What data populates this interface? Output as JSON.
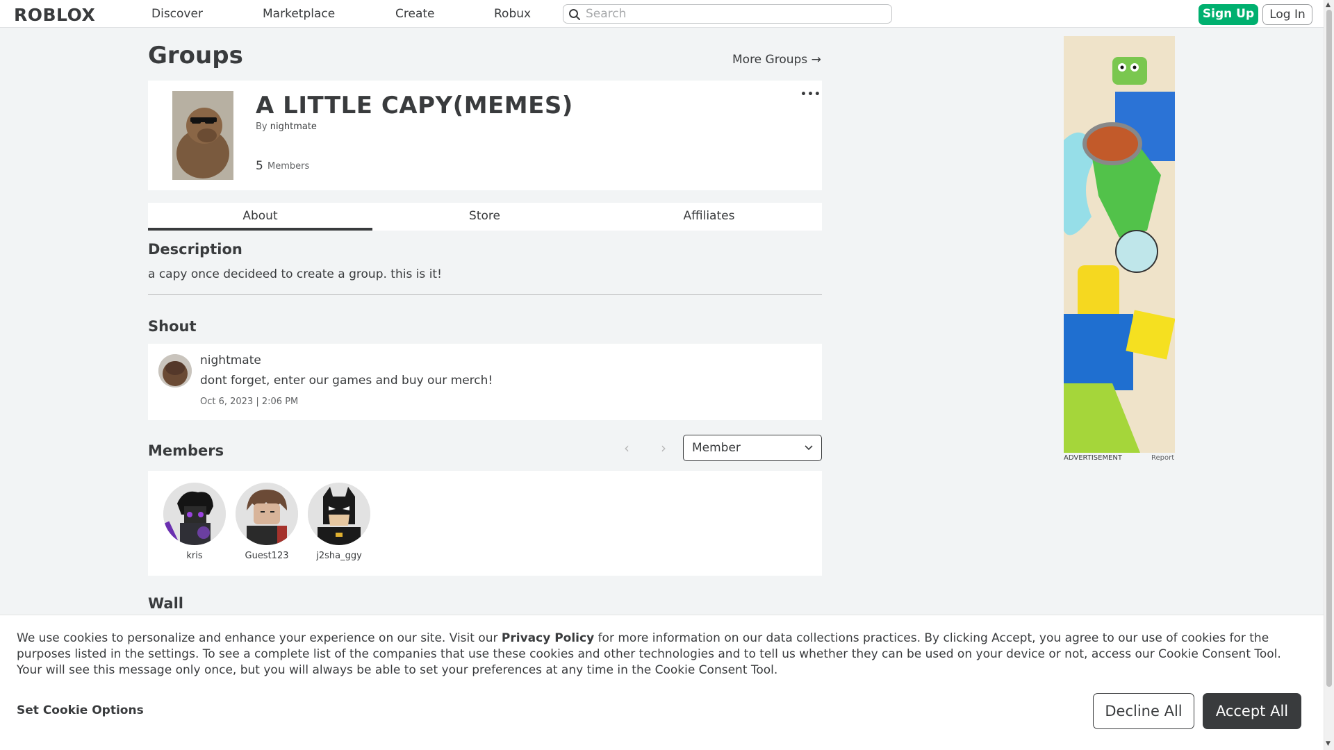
{
  "nav": {
    "logo": "ROBLOX",
    "links": [
      "Discover",
      "Marketplace",
      "Create",
      "Robux"
    ],
    "search_placeholder": "Search",
    "signup": "Sign Up",
    "login": "Log In"
  },
  "page": {
    "title": "Groups",
    "more_groups": "More Groups →"
  },
  "group": {
    "name": "A LITTLE CAPY(MEMES)",
    "by_label": "By",
    "owner": "nightmate",
    "member_count": "5",
    "members_label": "Members",
    "menu_icon": "ellipsis-icon"
  },
  "tabs": [
    "About",
    "Store",
    "Affiliates"
  ],
  "description": {
    "heading": "Description",
    "text": "a capy once decideed to create a group. this is it!"
  },
  "shout": {
    "heading": "Shout",
    "user": "nightmate",
    "message": "dont forget, enter our games and buy our merch!",
    "date": "Oct 6, 2023 | 2:06 PM"
  },
  "members": {
    "heading": "Members",
    "role_selected": "Member",
    "list": [
      {
        "name": "kris"
      },
      {
        "name": "Guest123"
      },
      {
        "name": "j2sha_ggy"
      }
    ]
  },
  "wall": {
    "heading": "Wall"
  },
  "ad": {
    "label": "ADVERTISEMENT",
    "report": "Report"
  },
  "cookie": {
    "text_before": "We use cookies to personalize and enhance your experience on our site. Visit our ",
    "privacy_link": "Privacy Policy",
    "text_after": " for more information on our data collections practices. By clicking Accept, you agree to our use of cookies for the purposes listed in the settings. To see a complete list of the companies that use these cookies and other technologies and to tell us whether they can be used on your device or not, access our Cookie Consent Tool. Your will see this message only once, but you will always be able to set your preferences at any time in the Cookie Consent Tool.",
    "options": "Set Cookie Options",
    "decline": "Decline All",
    "accept": "Accept All"
  },
  "colors": {
    "signup_green": "#00b06f",
    "accept_dark": "#393b3d",
    "page_bg": "#f2f4f5"
  }
}
